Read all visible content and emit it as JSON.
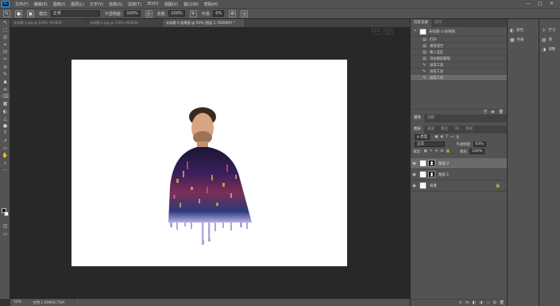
{
  "app": {
    "logo": "Ps"
  },
  "menu": [
    "文件(F)",
    "编辑(E)",
    "图像(I)",
    "图层(L)",
    "文字(Y)",
    "选择(S)",
    "滤镜(T)",
    "3D(D)",
    "视图(V)",
    "窗口(W)",
    "帮助(H)"
  ],
  "window_controls": [
    "—",
    "□",
    "✕"
  ],
  "options_bar": {
    "mode_label": "模式:",
    "mode_value": "正常",
    "opacity_label": "不透明度:",
    "opacity_value": "100%",
    "flow_label": "流量:",
    "flow_value": "100%",
    "smooth_label": "平滑:",
    "smooth_value": "0%"
  },
  "tabs": [
    {
      "label": "未标题-1.jpg @ 100% (RGB/8)",
      "active": false
    },
    {
      "label": "未标题-2.jpg @ 100% (RGB/8)",
      "active": false
    },
    {
      "label": "未标题-1-效果图 @ 50% (图层 1, RGB/8#) *",
      "active": true
    }
  ],
  "tools": [
    "↖",
    "⬚",
    "ʘ",
    "⌖",
    "⊡",
    "✂",
    "⊘",
    "✎",
    "▲",
    "≡",
    "⌫",
    "▦",
    "◐",
    "△",
    "●",
    "T",
    "↗",
    "▭",
    "✋",
    "⌕",
    "···"
  ],
  "watermark": "电脑",
  "statusbar": {
    "zoom": "50%",
    "doc": "文档:1.60M/6.75M",
    "arrow": "›"
  },
  "history": {
    "tabs": [
      "历史记录",
      "动作"
    ],
    "snapshot": "未标题-1-效果图",
    "items": [
      {
        "icon": "▤",
        "label": "打开"
      },
      {
        "icon": "▤",
        "label": "通道混合"
      },
      {
        "icon": "▤",
        "label": "载入选区"
      },
      {
        "icon": "▤",
        "label": "添加图层蒙版"
      },
      {
        "icon": "✎",
        "label": "画笔工具"
      },
      {
        "icon": "✎",
        "label": "画笔工具"
      },
      {
        "icon": "✎",
        "label": "画笔工具"
      }
    ],
    "footer_icons": [
      "⎘",
      "◉",
      "🗑"
    ]
  },
  "properties": {
    "tabs": [
      "属性",
      "调整"
    ]
  },
  "layers": {
    "tabs": [
      "图层",
      "通道",
      "路径",
      "3D",
      "样式"
    ],
    "filter_label": "ρ 类型",
    "blend_mode": "正常",
    "opacity_label": "不透明度:",
    "opacity_value": "63%",
    "lock_label": "锁定:",
    "fill_label": "填充:",
    "fill_value": "100%",
    "items": [
      {
        "name": "图层 2",
        "active": true
      },
      {
        "name": "图层 1",
        "active": false
      },
      {
        "name": "背景",
        "active": false
      }
    ],
    "footer_icons": [
      "⊝",
      "fx",
      "◧",
      "◑",
      "▭",
      "⊞",
      "🗑"
    ]
  },
  "collapsed_panels": [
    "颜色",
    "色板",
    "调整",
    "样式"
  ],
  "collapsed_panels2": [
    "学习",
    "库",
    "调整"
  ]
}
